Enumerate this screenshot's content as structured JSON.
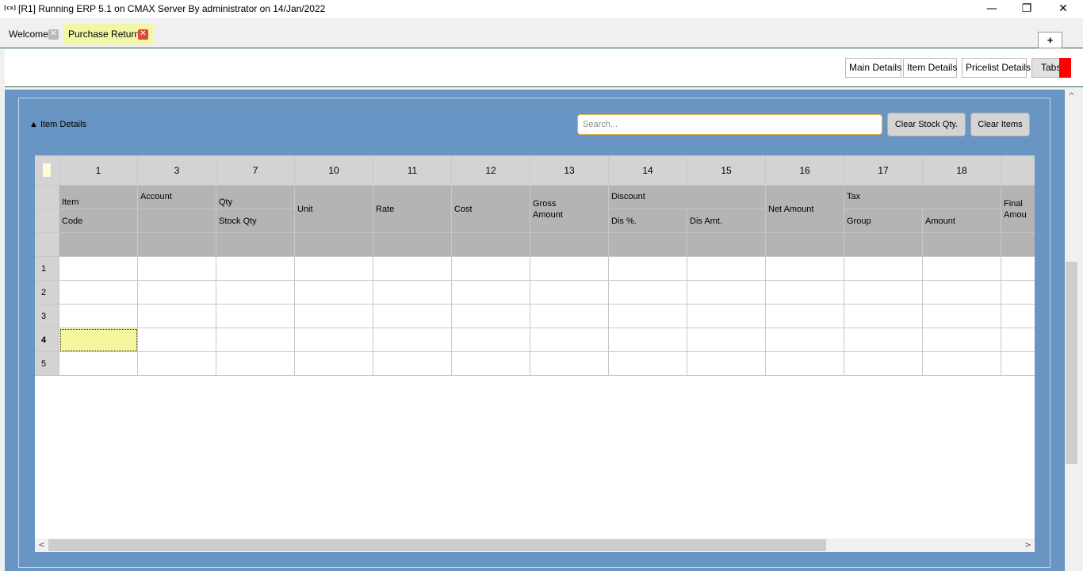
{
  "window": {
    "icon": "[cx]",
    "title": "[R1] Running ERP 5.1 on CMAX Server By administrator on 14/Jan/2022",
    "minimize": "—",
    "maximize": "❐",
    "close": "✕"
  },
  "tabs": [
    {
      "label": "Welcome",
      "active": false
    },
    {
      "label": "Purchase Return",
      "active": true
    }
  ],
  "tab_close_glyph": "✕",
  "new_tab_label": "+",
  "toolbar": {
    "main_details": "Main Details",
    "item_details": "Item Details",
    "pricelist_details": "Pricelist Details",
    "tabs": "Tabs"
  },
  "section": {
    "title": "▲ Item Details",
    "search_placeholder": "Search...",
    "clear_stock_qty": "Clear Stock Qty.",
    "clear_items": "Clear Items"
  },
  "grid": {
    "column_numbers": [
      "1",
      "3",
      "7",
      "10",
      "11",
      "12",
      "13",
      "14",
      "15",
      "16",
      "17",
      "18",
      ""
    ],
    "headers": {
      "item": "Item",
      "code": "Code",
      "account": "Account",
      "qty": "Qty",
      "stock_qty": "Stock Qty",
      "unit": "Unit",
      "rate": "Rate",
      "cost": "Cost",
      "gross_amount_1": "Gross",
      "gross_amount_2": "Amount",
      "discount": "Discount",
      "dis_pct": "Dis %.",
      "dis_amt": "Dis Amt.",
      "net_amount": "Net Amount",
      "tax": "Tax",
      "group": "Group",
      "amount": "Amount",
      "final_amount_1": "Final",
      "final_amount_2": "Amou"
    },
    "rows": [
      "1",
      "2",
      "3",
      "4",
      "5"
    ],
    "selected_row": "4"
  },
  "scroll": {
    "left": "<",
    "right": ">",
    "up": "^"
  },
  "colors": {
    "content_bg": "#6895c3",
    "active_tab": "#f2f7a6",
    "selected_cell": "#f5f7a0",
    "red_marker": "#ff0000"
  }
}
